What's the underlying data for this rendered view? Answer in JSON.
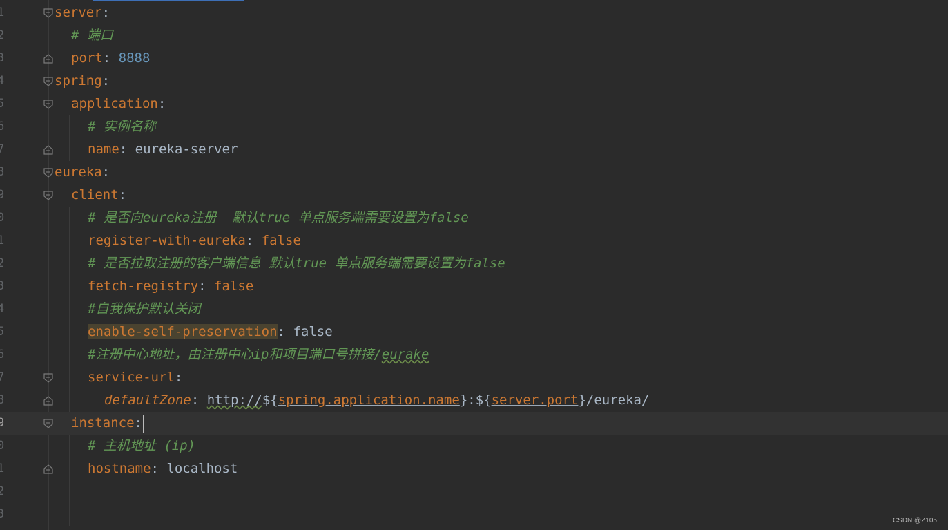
{
  "editor": {
    "lines": [
      {
        "num": "1",
        "key": "server",
        "colon": ":"
      },
      {
        "num": "2",
        "comment": "# 端口"
      },
      {
        "num": "3",
        "key": "port",
        "colon": ":",
        "value": "8888"
      },
      {
        "num": "4",
        "key": "spring",
        "colon": ":"
      },
      {
        "num": "5",
        "key": "application",
        "colon": ":"
      },
      {
        "num": "6",
        "comment": "# 实例名称"
      },
      {
        "num": "7",
        "key": "name",
        "colon": ":",
        "value": "eureka-server"
      },
      {
        "num": "8",
        "key": "eureka",
        "colon": ":"
      },
      {
        "num": "9",
        "key": "client",
        "colon": ":"
      },
      {
        "num": "0",
        "comment": "# 是否向eureka注册  默认true 单点服务端需要设置为false"
      },
      {
        "num": "1",
        "key": "register-with-eureka",
        "colon": ":",
        "value": "false"
      },
      {
        "num": "2",
        "comment": "# 是否拉取注册的客户端信息 默认true 单点服务端需要设置为false"
      },
      {
        "num": "3",
        "key": "fetch-registry",
        "colon": ":",
        "value": "false"
      },
      {
        "num": "4",
        "comment": "#自我保护默认关闭"
      },
      {
        "num": "5",
        "key": "enable-self-preservation",
        "colon": ":",
        "value": "false"
      },
      {
        "num": "6",
        "comment_a": "#注册中心地址，由注册中心ip和项目端口号拼接/",
        "comment_b": "eurake"
      },
      {
        "num": "7",
        "key": "service-url",
        "colon": ":"
      },
      {
        "num": "8",
        "key": "defaultZone",
        "colon": ":",
        "v1": "http://",
        "v2": "${",
        "v3": "spring.application.name",
        "v4": "}:${",
        "v5": "server.port",
        "v6": "}/eureka/"
      },
      {
        "num": "9",
        "key": "instance",
        "colon": ":"
      },
      {
        "num": "0",
        "comment": "# 主机地址 (ip)"
      },
      {
        "num": "1",
        "key": "hostname",
        "colon": ":",
        "value": "localhost"
      },
      {
        "num": "2"
      },
      {
        "num": "3"
      }
    ]
  },
  "watermark": "CSDN @Z105",
  "colors": {
    "background": "#2b2b2b",
    "key": "#cc7832",
    "comment": "#629755",
    "number": "#6897bb",
    "text": "#a9b7c6",
    "line_number": "#606366",
    "current_line": "#323232"
  }
}
